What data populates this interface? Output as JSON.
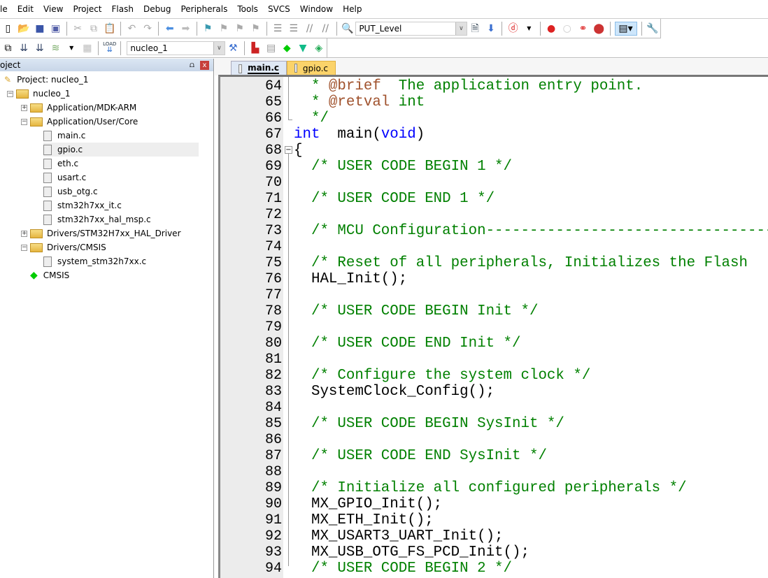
{
  "menu": [
    "le",
    "Edit",
    "View",
    "Project",
    "Flash",
    "Debug",
    "Peripherals",
    "Tools",
    "SVCS",
    "Window",
    "Help"
  ],
  "toolbar": {
    "find_combo": "PUT_Level",
    "target_combo": "nucleo_1",
    "load_label": "LOAD"
  },
  "project_panel": {
    "title": "oject",
    "pin": "⩍",
    "close": "x",
    "tree": [
      {
        "label": "Project: nucleo_1",
        "level": 0,
        "type": "project"
      },
      {
        "label": "nucleo_1",
        "level": 1,
        "type": "target",
        "toggle": "-"
      },
      {
        "label": "Application/MDK-ARM",
        "level": 2,
        "type": "folder",
        "toggle": "+"
      },
      {
        "label": "Application/User/Core",
        "level": 2,
        "type": "folder",
        "toggle": "-"
      },
      {
        "label": "main.c",
        "level": 3,
        "type": "file"
      },
      {
        "label": "gpio.c",
        "level": 3,
        "type": "file",
        "selected": true
      },
      {
        "label": "eth.c",
        "level": 3,
        "type": "file"
      },
      {
        "label": "usart.c",
        "level": 3,
        "type": "file"
      },
      {
        "label": "usb_otg.c",
        "level": 3,
        "type": "file"
      },
      {
        "label": "stm32h7xx_it.c",
        "level": 3,
        "type": "file"
      },
      {
        "label": "stm32h7xx_hal_msp.c",
        "level": 3,
        "type": "file"
      },
      {
        "label": "Drivers/STM32H7xx_HAL_Driver",
        "level": 2,
        "type": "folder",
        "toggle": "+"
      },
      {
        "label": "Drivers/CMSIS",
        "level": 2,
        "type": "folder",
        "toggle": "-"
      },
      {
        "label": "system_stm32h7xx.c",
        "level": 3,
        "type": "file"
      },
      {
        "label": "CMSIS",
        "level": 2,
        "type": "component"
      }
    ]
  },
  "tabs": [
    {
      "label": "main.c",
      "active": true
    },
    {
      "label": "gpio.c",
      "active": false
    }
  ],
  "colors": {
    "comment": "#008000",
    "doctag": "#a0522d",
    "keyword": "#0000ff",
    "tab_gpio": "#fbd36a"
  },
  "code": [
    {
      "n": "64",
      "t": [
        [
          "cm",
          "  * "
        ],
        [
          "dt",
          "@brief"
        ],
        [
          "cm",
          "  The application entry point."
        ]
      ]
    },
    {
      "n": "65",
      "t": [
        [
          "cm",
          "  * "
        ],
        [
          "dt",
          "@retval"
        ],
        [
          "cm",
          " int"
        ]
      ]
    },
    {
      "n": "66",
      "t": [
        [
          "cm",
          "  */"
        ]
      ]
    },
    {
      "n": "67",
      "t": [
        [
          "kw",
          "int"
        ],
        [
          "",
          "  main("
        ],
        [
          "kw",
          "void"
        ],
        [
          "",
          ")"
        ]
      ]
    },
    {
      "n": "68",
      "t": [
        [
          "",
          "{"
        ]
      ]
    },
    {
      "n": "69",
      "t": [
        [
          "cm",
          "  /* USER CODE BEGIN 1 */"
        ]
      ]
    },
    {
      "n": "70",
      "t": []
    },
    {
      "n": "71",
      "t": [
        [
          "cm",
          "  /* USER CODE END 1 */"
        ]
      ]
    },
    {
      "n": "72",
      "t": []
    },
    {
      "n": "73",
      "t": [
        [
          "cm",
          "  /* MCU Configuration--------------------------------------------------------"
        ]
      ]
    },
    {
      "n": "74",
      "t": []
    },
    {
      "n": "75",
      "t": [
        [
          "cm",
          "  /* Reset of all peripherals, Initializes the Flash"
        ]
      ]
    },
    {
      "n": "76",
      "t": [
        [
          "",
          "  HAL_Init();"
        ]
      ]
    },
    {
      "n": "77",
      "t": []
    },
    {
      "n": "78",
      "t": [
        [
          "cm",
          "  /* USER CODE BEGIN Init */"
        ]
      ]
    },
    {
      "n": "79",
      "t": []
    },
    {
      "n": "80",
      "t": [
        [
          "cm",
          "  /* USER CODE END Init */"
        ]
      ]
    },
    {
      "n": "81",
      "t": []
    },
    {
      "n": "82",
      "t": [
        [
          "cm",
          "  /* Configure the system clock */"
        ]
      ]
    },
    {
      "n": "83",
      "t": [
        [
          "",
          "  SystemClock_Config();"
        ]
      ]
    },
    {
      "n": "84",
      "t": []
    },
    {
      "n": "85",
      "t": [
        [
          "cm",
          "  /* USER CODE BEGIN SysInit */"
        ]
      ]
    },
    {
      "n": "86",
      "t": []
    },
    {
      "n": "87",
      "t": [
        [
          "cm",
          "  /* USER CODE END SysInit */"
        ]
      ]
    },
    {
      "n": "88",
      "t": []
    },
    {
      "n": "89",
      "t": [
        [
          "cm",
          "  /* Initialize all configured peripherals */"
        ]
      ]
    },
    {
      "n": "90",
      "t": [
        [
          "",
          "  MX_GPIO_Init();"
        ]
      ]
    },
    {
      "n": "91",
      "t": [
        [
          "",
          "  MX_ETH_Init();"
        ]
      ]
    },
    {
      "n": "92",
      "t": [
        [
          "",
          "  MX_USART3_UART_Init();"
        ]
      ]
    },
    {
      "n": "93",
      "t": [
        [
          "",
          "  MX_USB_OTG_FS_PCD_Init();"
        ]
      ]
    },
    {
      "n": "94",
      "t": [
        [
          "cm",
          "  /* USER CODE BEGIN 2 */"
        ]
      ]
    }
  ]
}
